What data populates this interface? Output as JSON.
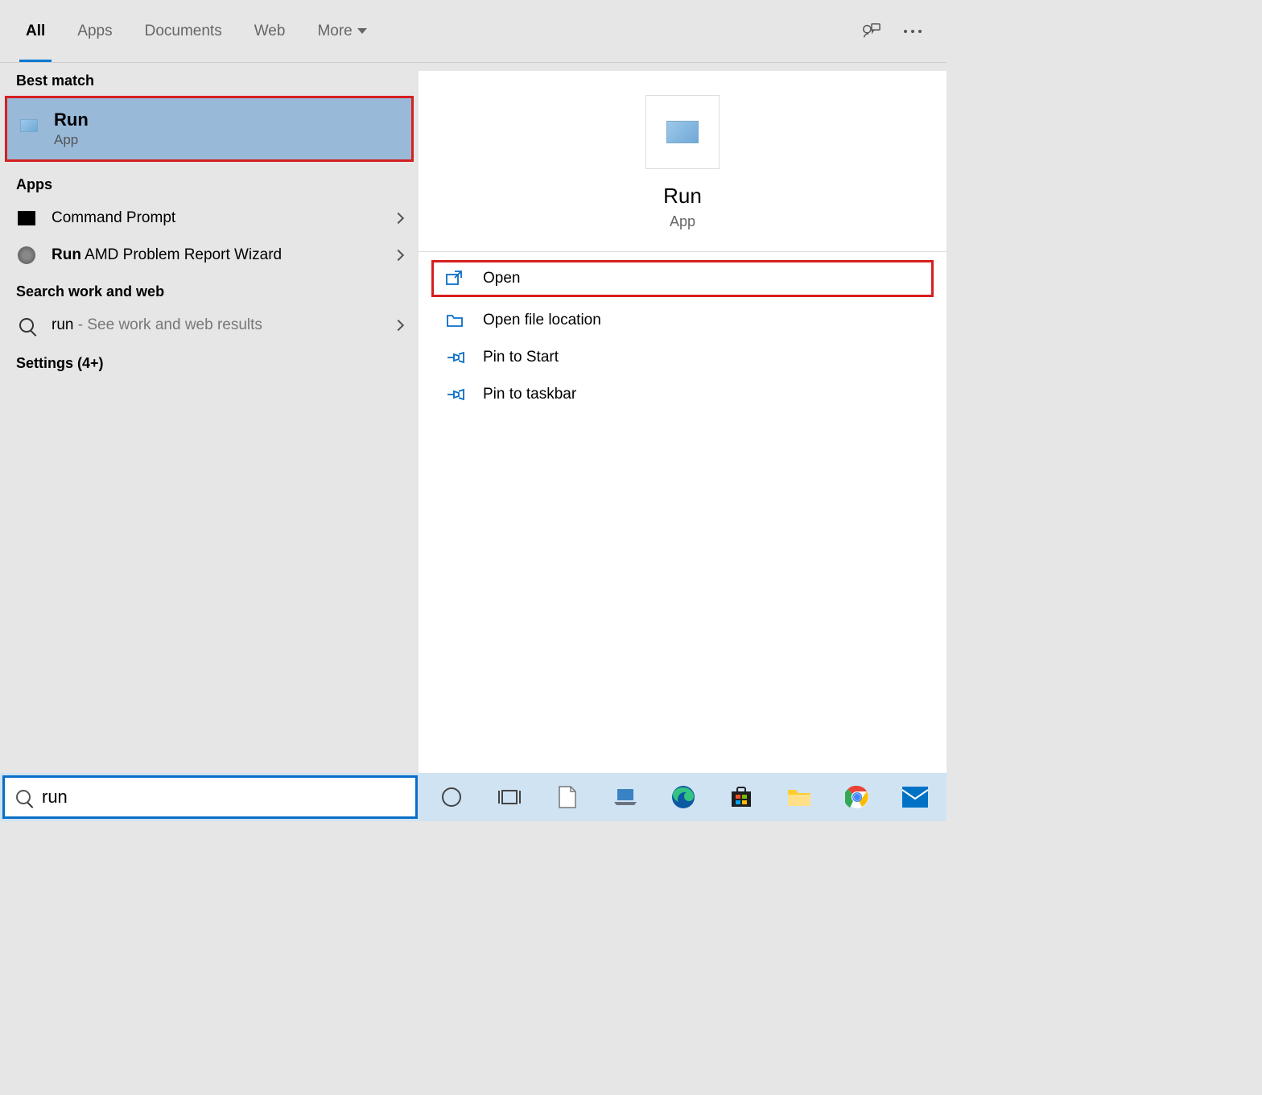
{
  "header": {
    "tabs": [
      {
        "label": "All",
        "active": true
      },
      {
        "label": "Apps"
      },
      {
        "label": "Documents"
      },
      {
        "label": "Web"
      },
      {
        "label": "More"
      }
    ]
  },
  "left": {
    "best_match_label": "Best match",
    "best_match": {
      "title": "Run",
      "subtitle": "App"
    },
    "apps_label": "Apps",
    "apps": [
      {
        "title": "Command Prompt",
        "bold_prefix": "",
        "rest": "Command Prompt"
      },
      {
        "title": "Run AMD Problem Report Wizard",
        "bold_prefix": "Run",
        "rest": " AMD Problem Report Wizard"
      }
    ],
    "search_label": "Search work and web",
    "web_row": {
      "query": "run",
      "suffix": " - See work and web results"
    },
    "settings_label": "Settings (4+)"
  },
  "detail": {
    "name": "Run",
    "type": "App",
    "actions": [
      {
        "label": "Open",
        "highlight": true,
        "icon": "open"
      },
      {
        "label": "Open file location",
        "icon": "folder"
      },
      {
        "label": "Pin to Start",
        "icon": "pin"
      },
      {
        "label": "Pin to taskbar",
        "icon": "pin"
      }
    ]
  },
  "search": {
    "value": "run"
  }
}
